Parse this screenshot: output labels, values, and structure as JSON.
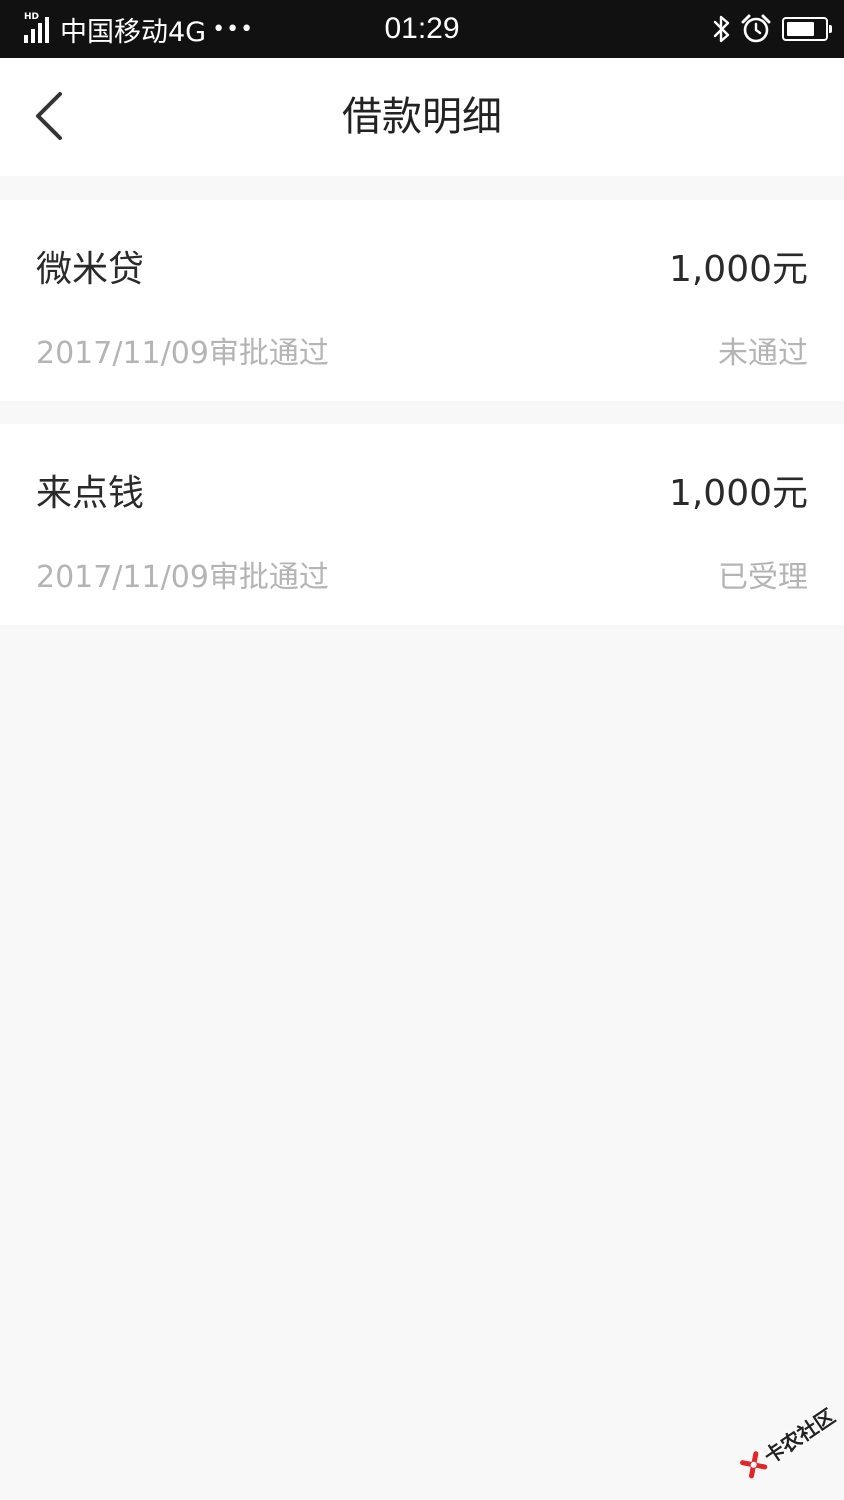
{
  "status_bar": {
    "network_tag": "HD",
    "carrier": "中国移动4G",
    "more": "•••",
    "time": "01:29",
    "icons": [
      "signal-icon",
      "bluetooth-icon",
      "alarm-icon",
      "battery-icon"
    ],
    "battery_level": 0.75
  },
  "nav": {
    "title": "借款明细",
    "back_icon": "chevron-left-icon"
  },
  "loans": [
    {
      "name": "微米贷",
      "amount": "1,000元",
      "date": "2017/11/09审批通过",
      "status": "未通过"
    },
    {
      "name": "来点钱",
      "amount": "1,000元",
      "date": "2017/11/09审批通过",
      "status": "已受理"
    }
  ],
  "watermark": {
    "text": "卡农社区",
    "icon": "kanong-logo-icon",
    "color": "#e0262b"
  },
  "colors": {
    "status_bar_bg": "#111111",
    "page_bg": "#f8f8f8",
    "card_bg": "#ffffff",
    "primary_text": "#2a2a2a",
    "secondary_text": "#b4b4b4"
  }
}
